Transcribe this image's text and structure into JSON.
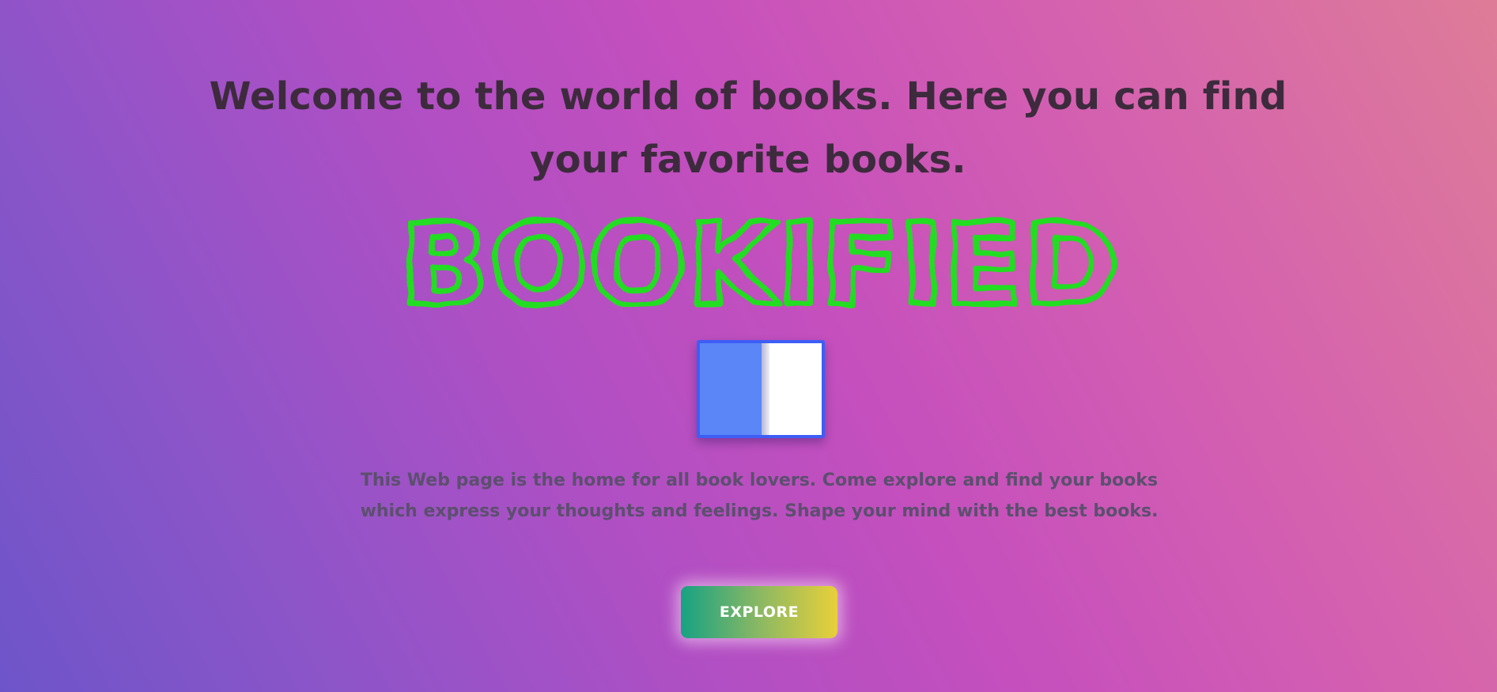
{
  "hero": {
    "heading": "Welcome to the world of books. Here you can find your favorite books.",
    "brand_logo_text": "BOOKIFIED",
    "description": "This Web page is the home for all book lovers. Come explore and find your books which express your thoughts and feelings. Shape your mind with the best books.",
    "explore_label": "EXPLORE"
  },
  "icons": {
    "book": "open-book-icon"
  },
  "colors": {
    "background_start": "#6d55c9",
    "background_end": "#de7c98",
    "brand_green": "#22dd22",
    "book_border": "#3d5ef5",
    "book_left_page": "#5a86f7",
    "button_gradient_start": "#17a283",
    "button_gradient_end": "#e8d039"
  }
}
